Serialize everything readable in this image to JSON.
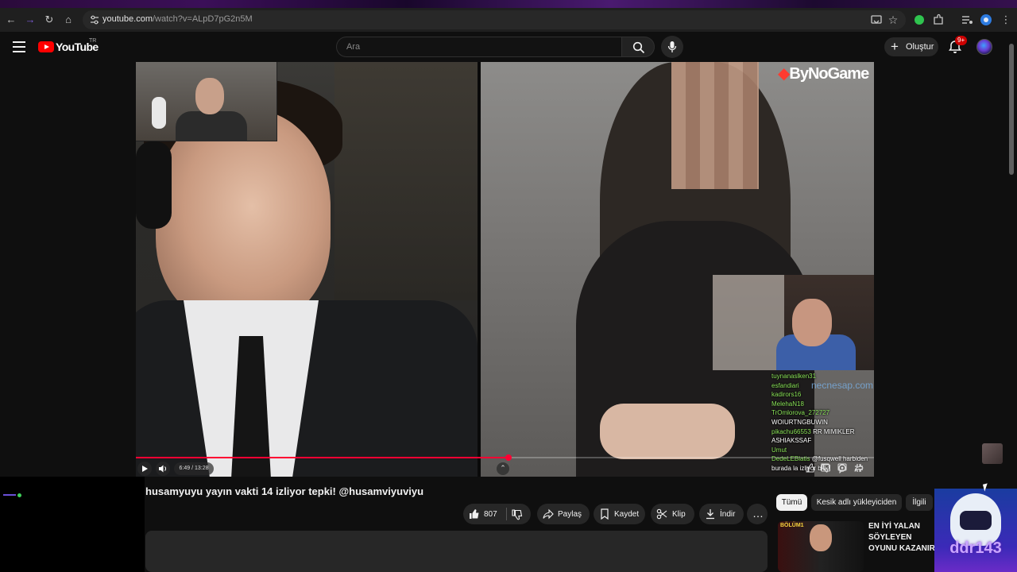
{
  "browser": {
    "url_host": "youtube.com",
    "url_path": "/watch?v=ALpD7pG2n5M"
  },
  "header": {
    "logo_text": "YouTube",
    "country_code": "TR",
    "search_placeholder": "Ara",
    "create_label": "Oluştur",
    "notification_count": "9+"
  },
  "video": {
    "watermark": "ByNoGame",
    "site_watermark": "necnesap.com",
    "time": "6:49 / 13:28",
    "progress": 0.505,
    "chat": [
      {
        "user": "tuynanaslken31",
        "msg": ""
      },
      {
        "user": "esfandiari",
        "msg": ""
      },
      {
        "user": "kadirors16",
        "msg": ""
      },
      {
        "user": "MelehaN18",
        "msg": ""
      },
      {
        "user": "TrOmlorova_272727",
        "msg": ""
      },
      {
        "user": "",
        "msg": "WOIURTNGBUWIN"
      },
      {
        "user": "pikachu66553",
        "msg": "RR MIMIKLER"
      },
      {
        "user": "",
        "msg": "ASHIAKSSAF"
      },
      {
        "user": "Umut",
        "msg": ""
      },
      {
        "user": "DedeLEBlatis",
        "msg": "@fusqwell harbiden"
      },
      {
        "user": "",
        "msg": "burada la izliyor bide"
      }
    ]
  },
  "info": {
    "title": "husamyuyu yayın vakti 14 izliyor tepki! @husamviyuviyu",
    "like_count": "807",
    "share_label": "Paylaş",
    "save_label": "Kaydet",
    "clip_label": "Klip",
    "download_label": "İndir"
  },
  "sidebar": {
    "chips": [
      "Tümü",
      "Kesik adlı yükleyiciden",
      "İlgili"
    ],
    "rec_badge": "BÖLÜM1",
    "rec_title": "EN İYİ YALAN SÖYLEYEN OYUNU KAZANIR"
  },
  "overlay": {
    "streamer_name": "ddr143"
  }
}
